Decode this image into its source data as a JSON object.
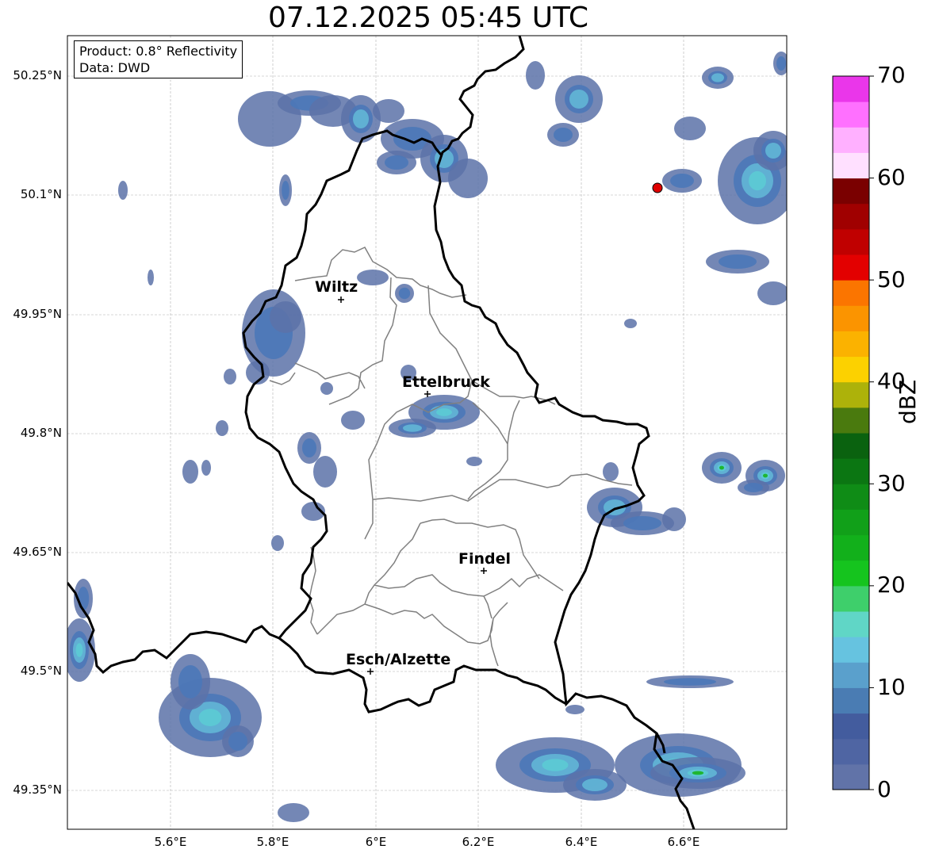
{
  "title": "07.12.2025 05:45 UTC",
  "info": {
    "product": "Product: 0.8° Reflectivity",
    "source": "Data: DWD"
  },
  "axes": {
    "lat_labels": [
      "50.25°N",
      "50.1°N",
      "49.95°N",
      "49.8°N",
      "49.65°N",
      "49.5°N",
      "49.35°N"
    ],
    "lon_labels": [
      "5.6°E",
      "5.8°E",
      "6°E",
      "6.2°E",
      "6.4°E",
      "6.6°E"
    ],
    "grid": true
  },
  "cities": [
    {
      "name": "Wiltz"
    },
    {
      "name": "Ettelbruck"
    },
    {
      "name": "Findel"
    },
    {
      "name": "Esch/Alzette"
    }
  ],
  "colorbar": {
    "unit": "dBZ",
    "tick_labels": [
      "0",
      "10",
      "20",
      "30",
      "40",
      "50",
      "60",
      "70"
    ],
    "range": [
      0,
      70
    ],
    "step": 5,
    "colors": [
      "#6173a8",
      "#4f65a3",
      "#435c9e",
      "#4a7cb3",
      "#5aa0cc",
      "#66c3e0",
      "#60d6c6",
      "#3ecf6b",
      "#15c41e",
      "#12b01b",
      "#11a019",
      "#0f8c16",
      "#0b7612",
      "#0a620f",
      "#4a7a0e",
      "#adb20a",
      "#fcd100",
      "#fbb200",
      "#fb9400",
      "#fb7500",
      "#e30000",
      "#c00000",
      "#a00000",
      "#7a0000",
      "#ffe0ff",
      "#ffb0ff",
      "#ff70ff",
      "#ea36ea"
    ]
  },
  "colors": {
    "border": "#000000",
    "district": "#808080",
    "gridline": "#b0b0b0",
    "marker": "#e00000"
  }
}
